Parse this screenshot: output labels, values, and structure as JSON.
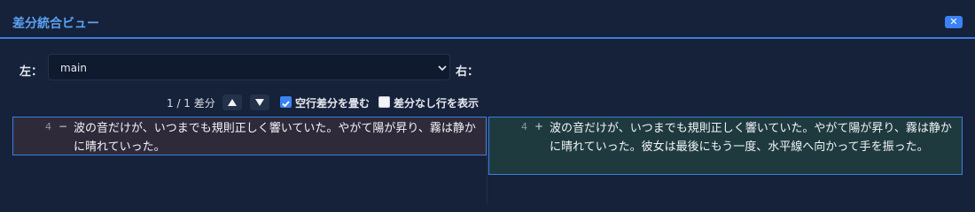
{
  "window": {
    "title": "差分統合ビュー",
    "close_label": "✕"
  },
  "toolbar": {
    "left_label": "左：",
    "left_select_value": "main",
    "right_label": "右：",
    "counter": "1 / 1 差分",
    "collapse_blank_label": "空行差分を畳む",
    "collapse_blank_checked": true,
    "show_same_label": "差分なし行を表示",
    "show_same_checked": false
  },
  "diff": {
    "left": {
      "line_no": "4",
      "mark": "−",
      "text": "波の音だけが、いつまでも規則正しく響いていた。やがて陽が昇り、霧は静かに晴れていった。"
    },
    "right": {
      "line_no": "4",
      "mark": "+",
      "text": "波の音だけが、いつまでも規則正しく響いていた。やがて陽が昇り、霧は静かに晴れていった。彼女は最後にもう一度、水平線へ向かって手を振った。"
    }
  },
  "colors": {
    "accent": "#3b82f6",
    "removed_bg": "#2e2a3a",
    "added_bg": "#1e3a3e"
  }
}
